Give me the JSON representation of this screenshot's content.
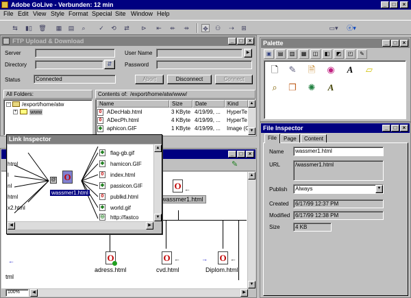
{
  "app": {
    "title": "Adobe GoLive - Verbunden: 12 min"
  },
  "menu": [
    "File",
    "Edit",
    "View",
    "Style",
    "Format",
    "Special",
    "Site",
    "Window",
    "Help"
  ],
  "ftp": {
    "title": "FTP Upload & Download",
    "server_label": "Server",
    "directory_label": "Directory",
    "status_label": "Status",
    "status_value": "Connected",
    "username_label": "User Name",
    "password_label": "Password",
    "abort_label": "Abort",
    "disconnect_label": "Disconnect",
    "connect_label": "Connect",
    "all_folders_label": "All Folders:",
    "folders": [
      "/export/home/atw",
      "www"
    ],
    "contents_label": "Contents of:",
    "contents_path": "/export/home/atw/www/",
    "columns": [
      "Name",
      "Size",
      "Date",
      "Kind"
    ],
    "files": [
      {
        "name": "ADecHab.html",
        "size": "3 KByte",
        "date": "4/19/99, ...",
        "kind": "HyperTe"
      },
      {
        "name": "ADecPh.html",
        "size": "4 KByte",
        "date": "4/19/99, ...",
        "kind": "HyperTe"
      },
      {
        "name": "aphicon.GIF",
        "size": "1 KByte",
        "date": "4/19/99, ...",
        "kind": "Image (G"
      }
    ]
  },
  "link_inspector": {
    "title": "Link Inspector",
    "left_items": [
      "html",
      "l",
      "nl",
      "html",
      "x2.html"
    ],
    "center_file": "wassmer1.html",
    "right_items": [
      "flag-gb.gif",
      "hamicon.GIF",
      "index.html",
      "passicon.GIF",
      "publkd.html",
      "world.gif",
      "http://fastco"
    ]
  },
  "site_view": {
    "center_file": "wassmer1.html",
    "files": [
      "adress.html",
      "cvd.html",
      "Diplom.html"
    ],
    "left_partial": "tml",
    "zoom": "100%"
  },
  "palette": {
    "title": "Palette"
  },
  "file_inspector": {
    "title": "File Inspector",
    "tabs": [
      "File",
      "Page",
      "Content"
    ],
    "name_label": "Name",
    "name_value": "wassmer1.html",
    "url_label": "URL",
    "url_value": "/wassmer1.html",
    "publish_label": "Publish",
    "publish_value": "Always",
    "created_label": "Created",
    "created_value": "6/17/99 12:37 PM",
    "modified_label": "Modified",
    "modified_value": "6/17/99 12:38 PM",
    "size_label": "Size",
    "size_value": "4 KB"
  }
}
